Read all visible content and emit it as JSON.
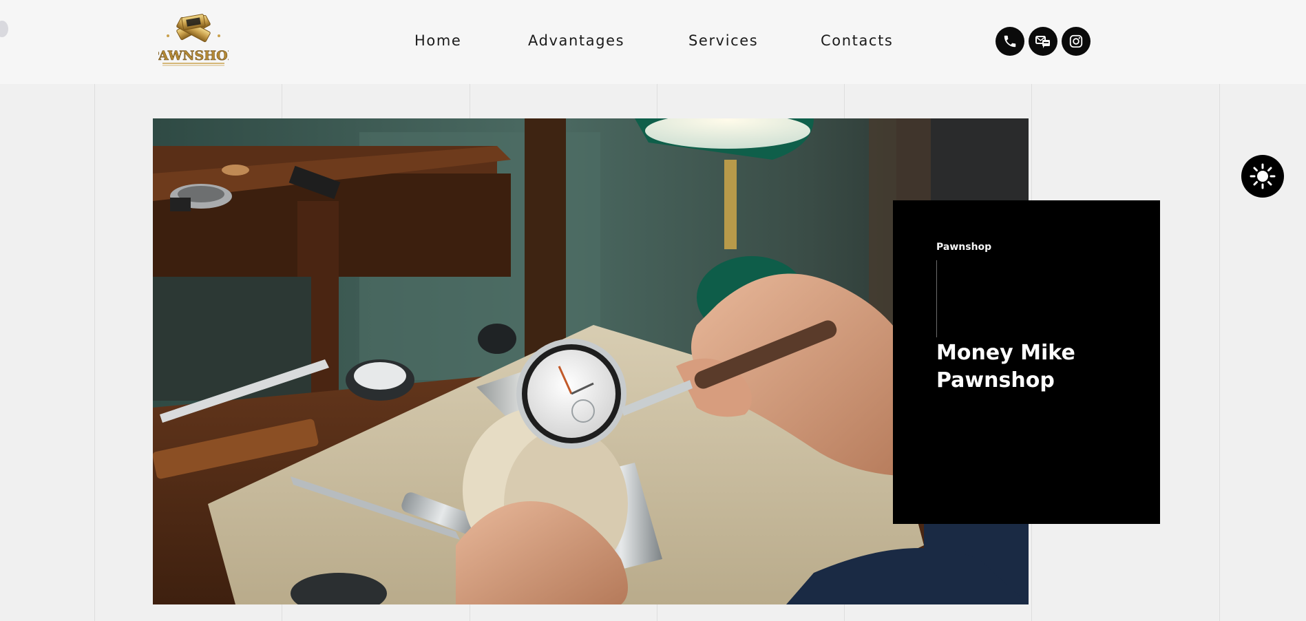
{
  "header": {
    "logo_text": "PAWNSHOP",
    "nav": [
      {
        "label": "Home"
      },
      {
        "label": "Advantages"
      },
      {
        "label": "Services"
      },
      {
        "label": "Contacts"
      }
    ],
    "social": [
      {
        "icon": "phone-icon"
      },
      {
        "icon": "messenger-icon"
      },
      {
        "icon": "instagram-icon"
      }
    ]
  },
  "hero": {
    "image_subject": "watchmaker-at-workbench-photo"
  },
  "card": {
    "eyebrow": "Pawnshop",
    "title": "Money Mike Pawnshop"
  },
  "theme_toggle": {
    "icon": "sun-icon"
  },
  "colors": {
    "background": "#f0f0f0",
    "header_background": "#f6f6f6",
    "card_background": "#000000",
    "accent_gold": "#c9a04c"
  }
}
